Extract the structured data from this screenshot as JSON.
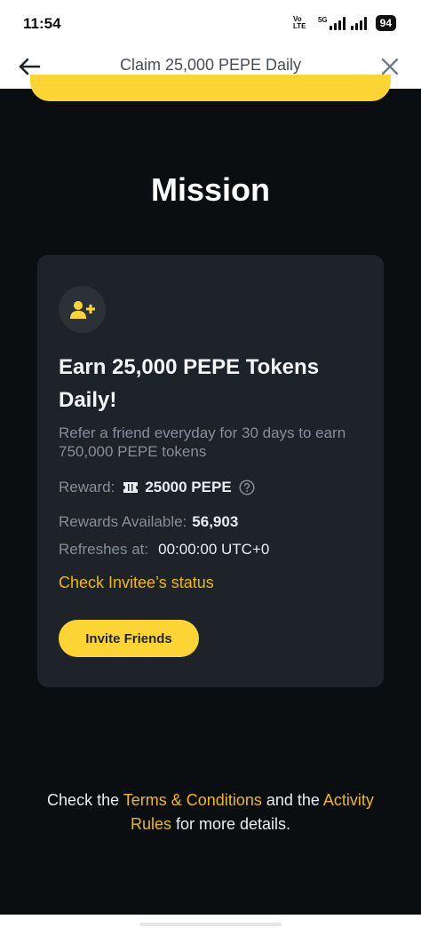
{
  "status_bar": {
    "time": "11:54",
    "network_label": "Vo LTE",
    "network_type": "5G",
    "battery": "94"
  },
  "header": {
    "title": "Claim 25,000 PEPE Daily",
    "back_icon": "arrow-left-icon",
    "close_icon": "close-icon"
  },
  "main": {
    "title": "Mission"
  },
  "card": {
    "icon": "add-user-icon",
    "heading": "Earn 25,000 PEPE Tokens Daily!",
    "description": "Refer a friend everyday for 30 days to earn 750,000 PEPE tokens",
    "reward_label": "Reward:",
    "reward_value": "25000 PEPE",
    "available_label": "Rewards Available:",
    "available_value": "56,903",
    "refresh_label": "Refreshes at:",
    "refresh_value": "00:00:00 UTC+0",
    "check_link": "Check Invitee’s status",
    "invite_button": "Invite Friends"
  },
  "footer": {
    "part1": "Check the ",
    "terms_link": "Terms & Conditions",
    "part2": " and the ",
    "rules_link": "Activity Rules",
    "part3": " for more details."
  },
  "colors": {
    "accent": "#fcd535",
    "link": "#f0b90b",
    "background": "#0b0e11",
    "card": "#1e2329"
  }
}
